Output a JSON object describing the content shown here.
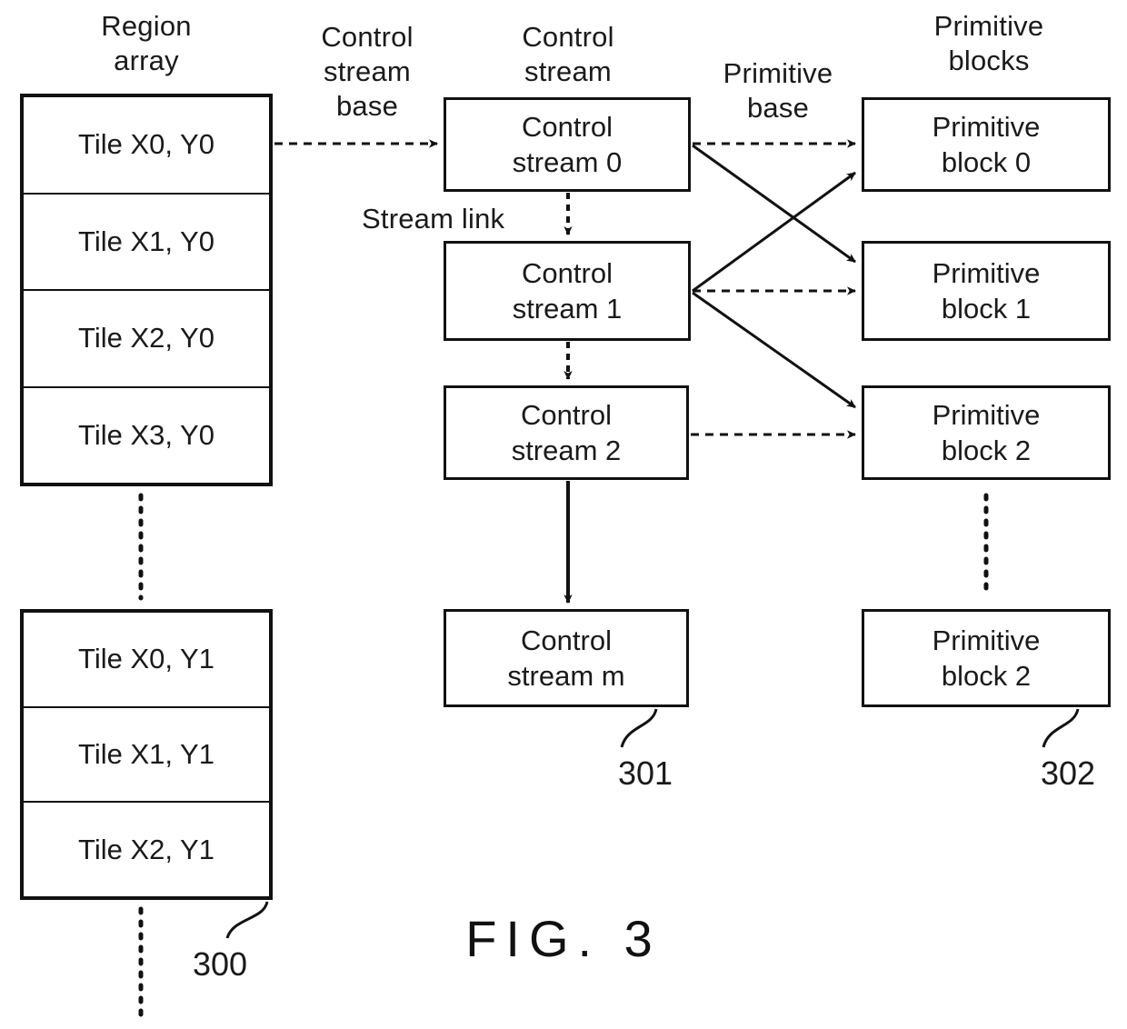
{
  "figure": {
    "caption": "FIG. 3"
  },
  "columns": {
    "region_array": {
      "title": "Region\narray"
    },
    "control_stream_base": {
      "title": "Control\nstream\nbase"
    },
    "control_stream": {
      "title": "Control\nstream"
    },
    "primitive_base": {
      "title": "Primitive\nbase"
    },
    "primitive_blocks": {
      "title": "Primitive\nblocks"
    }
  },
  "labels": {
    "stream_link": "Stream link"
  },
  "region_array_top": {
    "tiles": [
      {
        "label": "Tile X0, Y0"
      },
      {
        "label": "Tile X1, Y0"
      },
      {
        "label": "Tile X2, Y0"
      },
      {
        "label": "Tile X3, Y0"
      }
    ]
  },
  "region_array_bottom": {
    "tiles": [
      {
        "label": "Tile X0, Y1"
      },
      {
        "label": "Tile X1, Y1"
      },
      {
        "label": "Tile X2, Y1"
      }
    ],
    "ref": "300"
  },
  "control_streams": {
    "boxes": [
      {
        "label": "Control\nstream 0"
      },
      {
        "label": "Control\nstream 1"
      },
      {
        "label": "Control\nstream 2"
      },
      {
        "label": "Control\nstream m"
      }
    ],
    "ref": "301"
  },
  "primitive_blocks": {
    "boxes": [
      {
        "label": "Primitive\nblock 0"
      },
      {
        "label": "Primitive\nblock 1"
      },
      {
        "label": "Primitive\nblock 2"
      },
      {
        "label": "Primitive\nblock 2"
      }
    ],
    "ref": "302"
  }
}
